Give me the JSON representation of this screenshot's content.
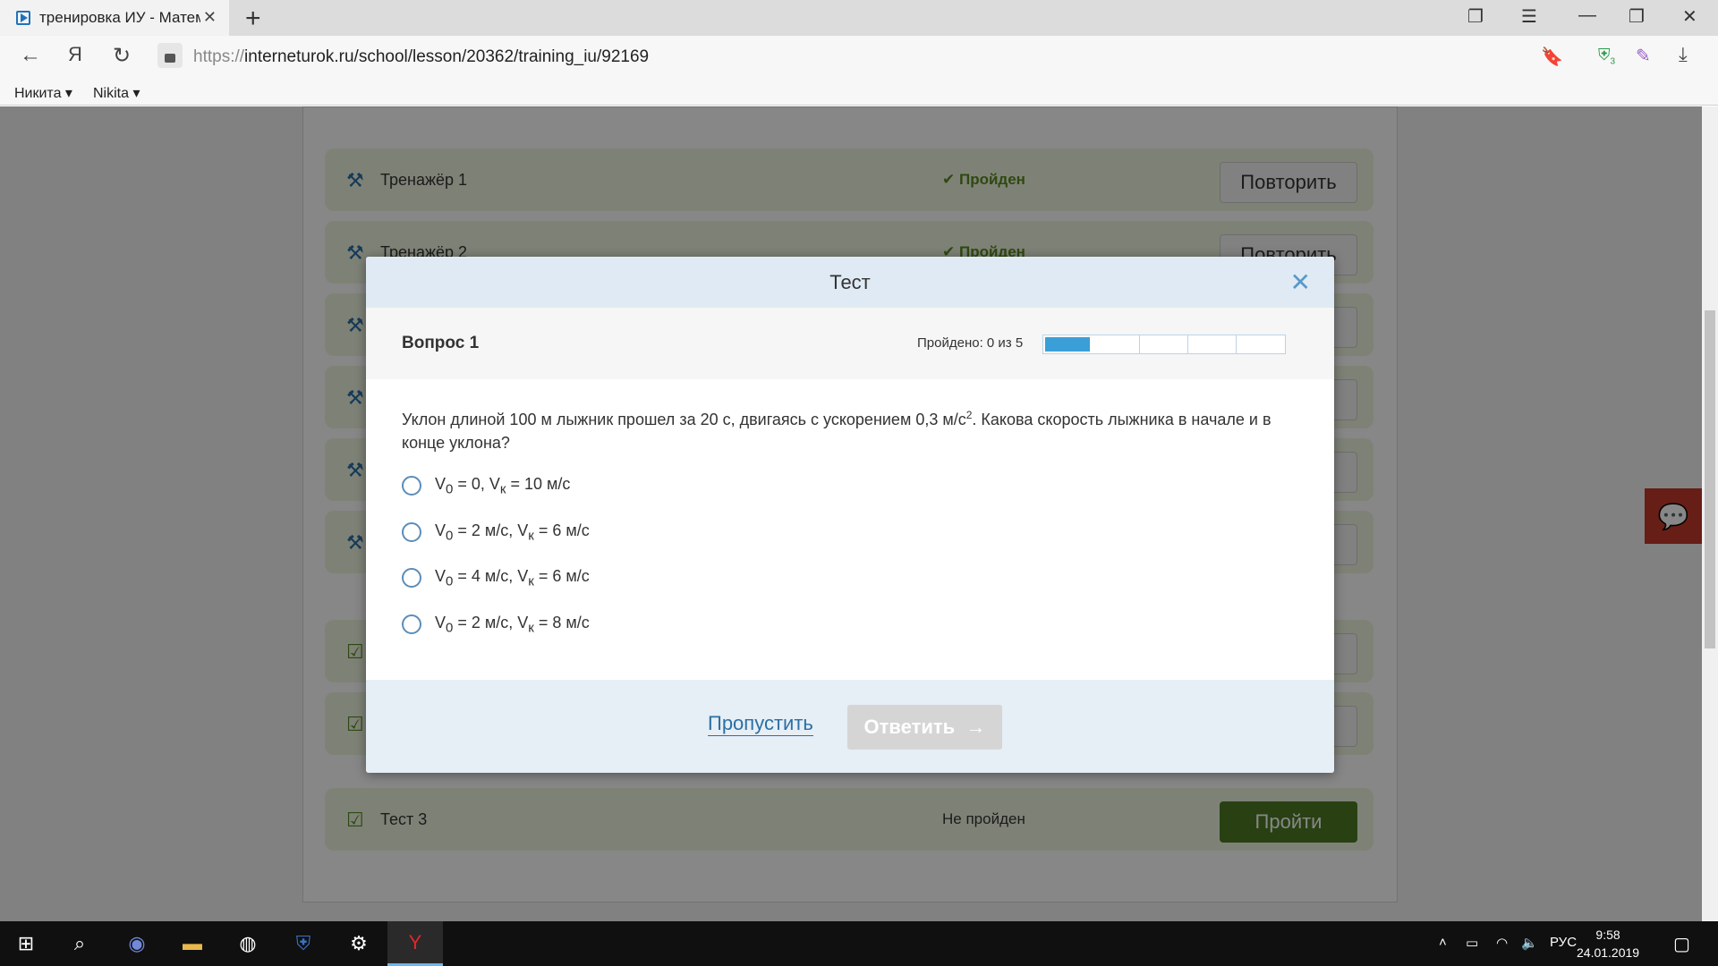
{
  "browser": {
    "tab_title": "тренировка ИУ - Матем",
    "url_scheme": "https://",
    "url_rest": "interneturok.ru/school/lesson/20362/training_iu/92169",
    "bookmarks": [
      "Никита ▾",
      "Nikita ▾"
    ],
    "extension_badge": "3"
  },
  "lesson": {
    "rows": [
      {
        "icon": "dumbbell-icon",
        "label": "Тренажёр 1",
        "status": "Пройден",
        "button": "Повторить",
        "passed": true
      },
      {
        "icon": "dumbbell-icon",
        "label": "Тренажёр 2",
        "status": "Пройден",
        "button": "Повторить",
        "passed": true
      },
      {
        "icon": "dumbbell-icon",
        "label": "",
        "status": "",
        "button": "",
        "passed": true
      },
      {
        "icon": "dumbbell-icon",
        "label": "",
        "status": "",
        "button": "",
        "passed": true
      },
      {
        "icon": "dumbbell-icon",
        "label": "",
        "status": "",
        "button": "",
        "passed": true
      },
      {
        "icon": "dumbbell-icon",
        "label": "",
        "status": "",
        "button": "",
        "passed": true
      },
      {
        "icon": "test-icon",
        "label": "",
        "status": "",
        "button": "",
        "passed": true
      },
      {
        "icon": "test-icon",
        "label": "",
        "status": "",
        "button": "",
        "passed": true
      },
      {
        "icon": "test-icon",
        "label": "Тест 3",
        "status": "Не пройден",
        "button": "Пройти",
        "passed": false
      }
    ]
  },
  "modal": {
    "title": "Тест",
    "question_label": "Вопрос 1",
    "progress_text": "Пройдено: 0 из 5",
    "progress": {
      "current": 1,
      "total": 5
    },
    "question_text_a": "Уклон длиной 100 м лыжник прошел за 20 с, двигаясь с ускорением 0,3 м/с",
    "question_sup": "2",
    "question_text_b": ". Какова скорость лыжника в начале и в конце уклона?",
    "options": [
      {
        "v0": "0",
        "vk": "10 м/с"
      },
      {
        "v0": "2 м/с",
        "vk": "6 м/с"
      },
      {
        "v0": "4 м/с",
        "vk": "6 м/с"
      },
      {
        "v0": "2 м/с",
        "vk": "8 м/с"
      }
    ],
    "skip_label": "Пропустить",
    "answer_label": "Ответить"
  },
  "taskbar": {
    "lang": "РУС",
    "time": "9:58",
    "date": "24.01.2019"
  }
}
